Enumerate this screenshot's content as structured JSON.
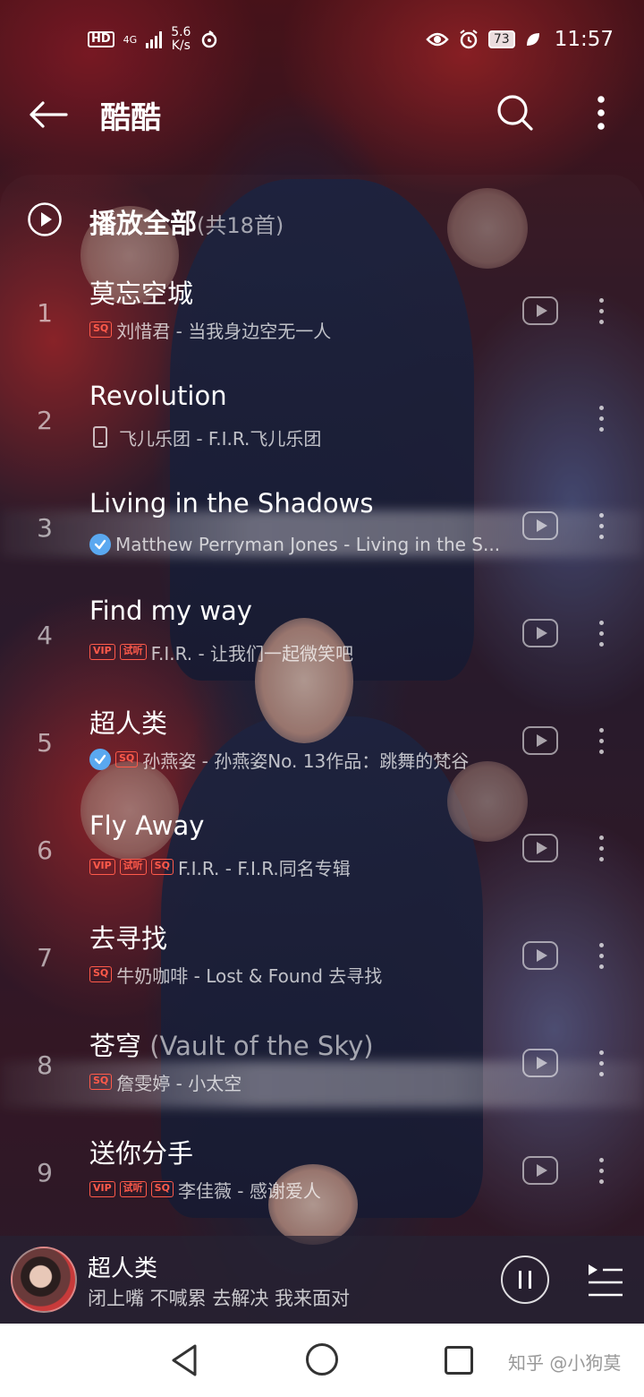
{
  "status_bar": {
    "hd": "HD",
    "network": "4G",
    "speed_value": "5.6",
    "speed_unit": "K/s",
    "battery": "73",
    "time": "11:57"
  },
  "header": {
    "title": "酷酷",
    "back_icon": "arrow-left-icon",
    "search_icon": "search-icon",
    "more_icon": "more-vertical-icon"
  },
  "play_all": {
    "label": "播放全部",
    "count": "(共18首)"
  },
  "songs": [
    {
      "index": "1",
      "title": "莫忘空城",
      "title_sub": "",
      "tags": [
        "SQ"
      ],
      "verified": false,
      "local": false,
      "meta": "刘惜君 - 当我身边空无一人"
    },
    {
      "index": "2",
      "title": "Revolution",
      "title_sub": "",
      "tags": [],
      "verified": false,
      "local": true,
      "meta": "飞儿乐团 - F.I.R.飞儿乐团"
    },
    {
      "index": "3",
      "title": "Living in the Shadows",
      "title_sub": "",
      "tags": [],
      "verified": true,
      "local": false,
      "meta": "Matthew Perryman Jones - Living in the S..."
    },
    {
      "index": "4",
      "title": "Find my way",
      "title_sub": "",
      "tags": [
        "VIP",
        "试听"
      ],
      "verified": false,
      "local": false,
      "meta": "F.I.R. - 让我们一起微笑吧"
    },
    {
      "index": "5",
      "title": "超人类",
      "title_sub": "",
      "tags": [
        "SQ"
      ],
      "verified": true,
      "local": false,
      "meta": "孙燕姿 - 孙燕姿No. 13作品：跳舞的梵谷"
    },
    {
      "index": "6",
      "title": "Fly Away",
      "title_sub": "",
      "tags": [
        "VIP",
        "试听",
        "SQ"
      ],
      "verified": false,
      "local": false,
      "meta": "F.I.R. - F.I.R.同名专辑"
    },
    {
      "index": "7",
      "title": "去寻找",
      "title_sub": "",
      "tags": [
        "SQ"
      ],
      "verified": false,
      "local": false,
      "meta": "牛奶咖啡 - Lost & Found 去寻找"
    },
    {
      "index": "8",
      "title": "苍穹",
      "title_sub": " (Vault of the Sky)",
      "tags": [
        "SQ"
      ],
      "verified": false,
      "local": false,
      "meta": "詹雯婷 - 小太空"
    },
    {
      "index": "9",
      "title": "送你分手",
      "title_sub": "",
      "tags": [
        "VIP",
        "试听",
        "SQ"
      ],
      "verified": false,
      "local": false,
      "meta": "李佳薇 - 感谢爱人"
    }
  ],
  "mini_player": {
    "title": "超人类",
    "lyric": "闭上嘴 不喊累 去解决 我来面对",
    "pause_icon": "pause-icon",
    "queue_icon": "playlist-icon"
  },
  "nav": {
    "back_icon": "triangle-back-icon",
    "home_icon": "circle-home-icon",
    "recent_icon": "square-recent-icon"
  },
  "watermark": "知乎 @小狗莫",
  "colors": {
    "accent_tag": "#ff5a4a",
    "verified": "#5aa8f0"
  }
}
